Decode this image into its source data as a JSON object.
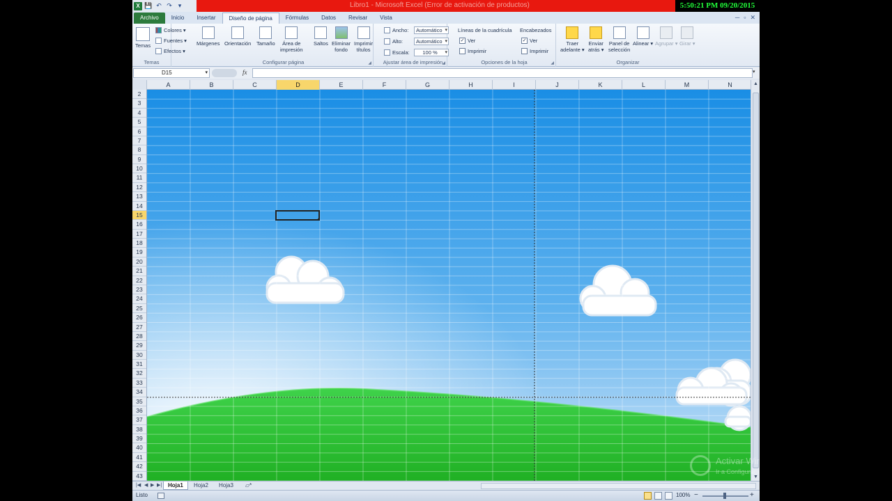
{
  "clock": "5:50:21 PM 09/20/2015",
  "window": {
    "title": "Libro1  -  Microsoft Excel (Error de activación de productos)",
    "controls": [
      "─",
      "▫",
      "✕"
    ]
  },
  "qat": {
    "excel": "X",
    "save": "💾",
    "undo": "↶",
    "redo": "↷",
    "customize": "▾"
  },
  "tabs": [
    "Archivo",
    "Inicio",
    "Insertar",
    "Diseño de página",
    "Fórmulas",
    "Datos",
    "Revisar",
    "Vista"
  ],
  "active_tab": "Diseño de página",
  "ribbon": {
    "temas": {
      "label": "Temas",
      "temas_button": "Temas",
      "colores": "Colores ▾",
      "fuentes": "Fuentes ▾",
      "efectos": "Efectos ▾"
    },
    "configurar": {
      "label": "Configurar página",
      "margenes": "Márgenes",
      "orientacion": "Orientación",
      "tamano": "Tamaño",
      "area1": "Área de",
      "area2": "impresión",
      "saltos": "Saltos",
      "eliminar1": "Eliminar",
      "eliminar2": "fondo",
      "imprimir1": "Imprimir",
      "imprimir2": "títulos"
    },
    "ajustar": {
      "label": "Ajustar área de impresión",
      "ancho_label": "Ancho:",
      "ancho_value": "Automático",
      "alto_label": "Alto:",
      "alto_value": "Automático",
      "escala_label": "Escala:",
      "escala_value": "100 %"
    },
    "opciones": {
      "label": "Opciones de la hoja",
      "lineas": "Líneas de la cuadrícula",
      "encabezados": "Encabezados",
      "ver": "Ver",
      "imprimir": "Imprimir",
      "lineas_ver_checked": true,
      "lineas_imprimir_checked": false,
      "enc_ver_checked": true,
      "enc_imprimir_checked": false
    },
    "organizar": {
      "label": "Organizar",
      "traer1": "Traer",
      "traer2": "adelante ▾",
      "enviar1": "Enviar",
      "enviar2": "atrás ▾",
      "panel1": "Panel de",
      "panel2": "selección",
      "alinear": "Alinear ▾",
      "agrupar": "Agrupar ▾",
      "girar": "Girar ▾"
    }
  },
  "formula_bar": {
    "name_box": "D15",
    "fx": "fx",
    "formula": ""
  },
  "columns": [
    "A",
    "B",
    "C",
    "D",
    "E",
    "F",
    "G",
    "H",
    "I",
    "J",
    "K",
    "L",
    "M",
    "N"
  ],
  "selected_column": "D",
  "rows": [
    "2",
    "3",
    "4",
    "5",
    "6",
    "7",
    "8",
    "9",
    "10",
    "11",
    "12",
    "13",
    "14",
    "15",
    "16",
    "17",
    "18",
    "19",
    "20",
    "21",
    "22",
    "23",
    "24",
    "25",
    "26",
    "27",
    "28",
    "29",
    "30",
    "31",
    "32",
    "33",
    "34",
    "35",
    "36",
    "37",
    "38",
    "39",
    "40",
    "41",
    "42",
    "43"
  ],
  "selected_row": "15",
  "sheet_tabs": [
    "Hoja1",
    "Hoja2",
    "Hoja3"
  ],
  "active_sheet": "Hoja1",
  "status": {
    "text": "Listo",
    "zoom": "100%",
    "minus": "−",
    "plus": "+"
  },
  "watermark": {
    "title": "Activar Windows",
    "subtitle": "Ir a Configuración de PC para activar Windows."
  },
  "colors": {
    "sky_top": "#1a8ee5",
    "sky_bottom": "#dcedfb",
    "hill_light": "#3fd24a",
    "hill_dark": "#1fa320",
    "title_bar": "#e8180f",
    "clock_text": "#21ff3a",
    "selection_highlight": "#f8d66b"
  }
}
